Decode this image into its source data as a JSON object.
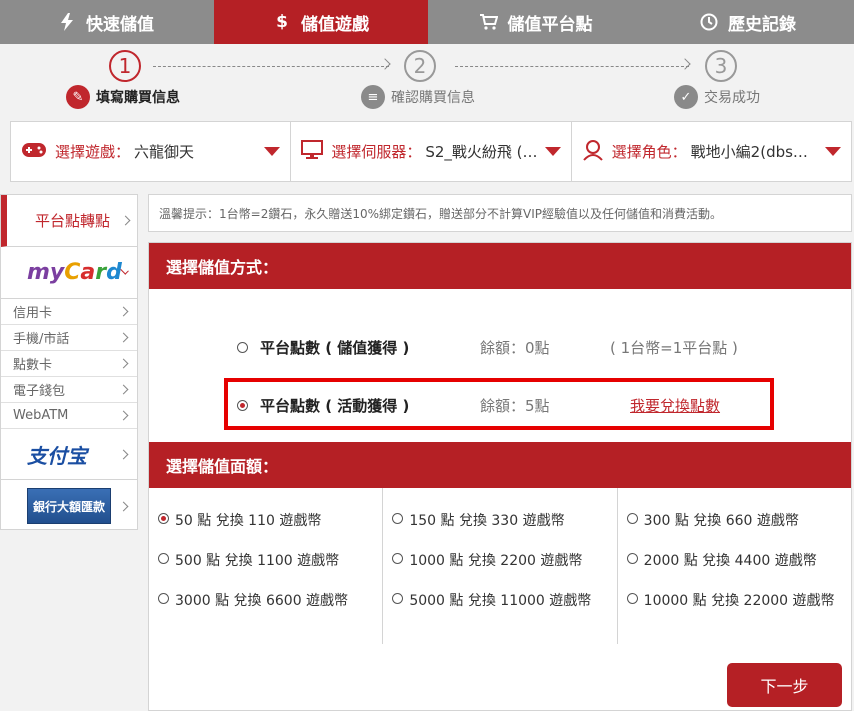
{
  "tabs": [
    {
      "label": "快速儲值",
      "icon": "lightning-icon"
    },
    {
      "label": "儲值遊戲",
      "icon": "dollar-icon"
    },
    {
      "label": "儲值平台點",
      "icon": "cart-icon"
    },
    {
      "label": "歷史記錄",
      "icon": "clock-icon"
    }
  ],
  "steps": [
    {
      "num": "1",
      "label": "填寫購買信息"
    },
    {
      "num": "2",
      "label": "確認購買信息"
    },
    {
      "num": "3",
      "label": "交易成功"
    }
  ],
  "selectors": {
    "game": {
      "label": "選擇遊戲：",
      "value": "六龍御天"
    },
    "server": {
      "label": "選擇伺服器：",
      "value": "S2_戰火紛飛 (…"
    },
    "role": {
      "label": "選擇角色：",
      "value": "戰地小編2(dbs…"
    }
  },
  "sidebar": {
    "main_label": "平台點轉點",
    "mycard_logo": "MyCard",
    "sub_items": [
      "信用卡",
      "手機/市話",
      "點數卡",
      "電子錢包",
      "WebATM"
    ],
    "alipay_logo": "支付宝",
    "bank_logo": "銀行大額匯款"
  },
  "notice": "溫馨提示：1台幣=2鑽石，永久贈送10%綁定鑽石，贈送部分不計算VIP經驗值以及任何儲值和消費活動。",
  "method_section": {
    "title": "選擇儲值方式：",
    "methods": [
      {
        "name": "平台點數 ( 儲值獲得 )",
        "balance": "餘額：0點",
        "note": "( 1台幣=1平台點 )"
      },
      {
        "name": "平台點數 ( 活動獲得 )",
        "balance": "餘額：5點",
        "link": "我要兌換點數"
      }
    ]
  },
  "amount_section": {
    "title": "選擇儲值面額：",
    "columns": [
      [
        "50 點 兌換 110 遊戲幣",
        "500 點 兌換 1100 遊戲幣",
        "3000 點 兌換 6600 遊戲幣"
      ],
      [
        "150 點 兌換 330 遊戲幣",
        "1000 點 兌換 2200 遊戲幣",
        "5000 點 兌換 11000 遊戲幣"
      ],
      [
        "300 點 兌換 660 遊戲幣",
        "2000 點 兌換 4400 遊戲幣",
        "10000 點 兌換 22000 遊戲幣"
      ]
    ]
  },
  "next_button": "下一步",
  "colors": {
    "accent": "#b52025",
    "highlight": "#e60000",
    "tab_bg": "#8c8c8c"
  }
}
